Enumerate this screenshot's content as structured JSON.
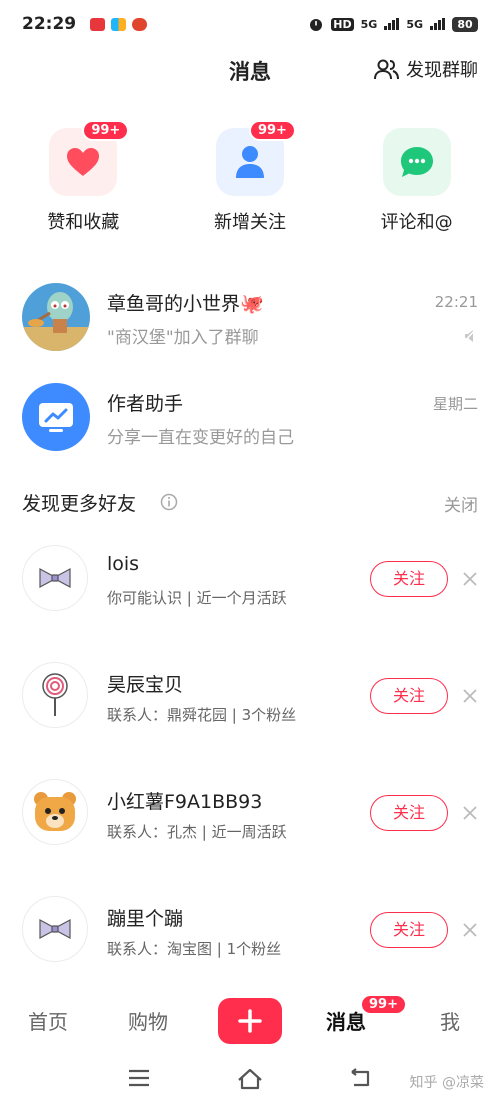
{
  "status_bar": {
    "time": "22:29",
    "network_labels": [
      "HD",
      "5G",
      "5G"
    ],
    "battery": "80"
  },
  "header": {
    "title": "消息",
    "discover_group_label": "发现群聊"
  },
  "categories": [
    {
      "label": "赞和收藏",
      "badge": "99+",
      "icon": "heart-icon",
      "color": "#ff4d5e",
      "bg": "#ffeeee"
    },
    {
      "label": "新增关注",
      "badge": "99+",
      "icon": "person-icon",
      "color": "#3d8bff",
      "bg": "#eaf2ff"
    },
    {
      "label": "评论和@",
      "badge": "",
      "icon": "chat-bubble-icon",
      "color": "#1ec77a",
      "bg": "#e7f8ee"
    }
  ],
  "conversations": [
    {
      "title": "章鱼哥的小世界🐙",
      "subtitle": "\"商汉堡\"加入了群聊",
      "time": "22:21",
      "muted": true
    },
    {
      "title": "作者助手",
      "subtitle": "分享一直在变更好的自己",
      "time": "星期二",
      "muted": false
    }
  ],
  "discover": {
    "title": "发现更多好友",
    "close_label": "关闭",
    "friends": [
      {
        "name": "lois",
        "meta": "你可能认识 | 近一个月活跃",
        "follow_label": "关注",
        "avatar": "bowtie"
      },
      {
        "name": "昊辰宝贝",
        "meta": "联系人：鼎舜花园 | 3个粉丝",
        "follow_label": "关注",
        "avatar": "lollipop"
      },
      {
        "name": "小红薯F9A1BB93",
        "meta": "联系人：孔杰 | 近一周活跃",
        "follow_label": "关注",
        "avatar": "bear"
      },
      {
        "name": "蹦里个蹦",
        "meta": "联系人：淘宝图 | 1个粉丝",
        "follow_label": "关注",
        "avatar": "bowtie"
      }
    ]
  },
  "bottom_nav": {
    "items": [
      "首页",
      "购物",
      "消息",
      "我"
    ],
    "active": "消息",
    "message_badge": "99+"
  },
  "watermark": "知乎 @凉菜",
  "accent_color": "#ff2e4d"
}
